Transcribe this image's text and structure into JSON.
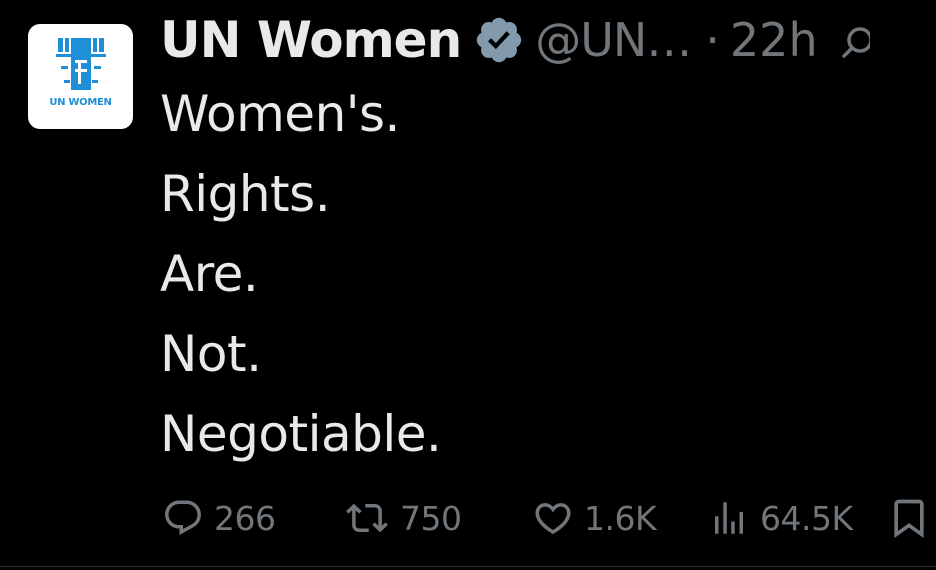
{
  "account": {
    "name": "UN Women",
    "handle": "@UN…",
    "separator": "·",
    "time": "22h",
    "avatar_text": "UN WOMEN",
    "verified_color": "#829aab"
  },
  "tweet": {
    "lines": [
      "Women's.",
      "Rights.",
      "Are.",
      "Not.",
      "Negotiable."
    ]
  },
  "actions": {
    "replies": "266",
    "reposts": "750",
    "likes": "1.6K",
    "views": "64.5K"
  },
  "colors": {
    "background": "#000000",
    "text": "#e7e9ea",
    "muted": "#71767b",
    "brand_blue": "#1f8fd8"
  },
  "icons": {
    "reply": "reply-icon",
    "repost": "repost-icon",
    "like": "heart-icon",
    "views": "views-icon",
    "bookmark": "bookmark-icon",
    "more": "grok-icon"
  }
}
